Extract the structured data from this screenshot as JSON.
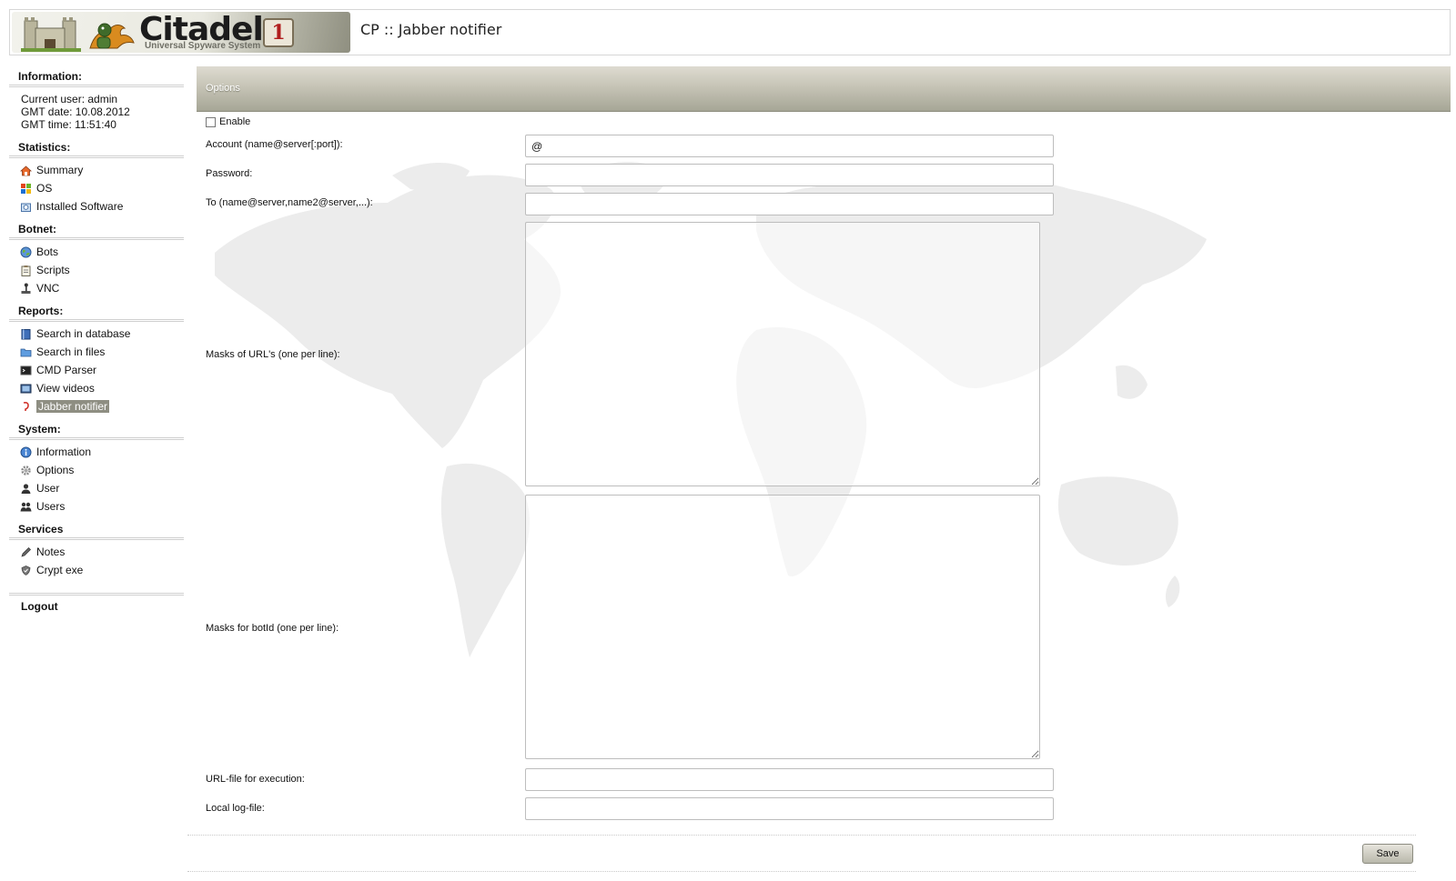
{
  "header": {
    "logo_text": "Citadel",
    "logo_badge": "1",
    "logo_subtitle": "Universal Spyware System",
    "page_title": "CP :: Jabber notifier"
  },
  "sidebar": {
    "information_title": "Information:",
    "info_lines": [
      "Current user: admin",
      "GMT date: 10.08.2012",
      "GMT time: 11:51:40"
    ],
    "statistics_title": "Statistics:",
    "statistics_items": [
      "Summary",
      "OS",
      "Installed Software"
    ],
    "botnet_title": "Botnet:",
    "botnet_items": [
      "Bots",
      "Scripts",
      "VNC"
    ],
    "reports_title": "Reports:",
    "reports_items": [
      "Search in database",
      "Search in files",
      "CMD Parser",
      "View videos",
      "Jabber notifier"
    ],
    "system_title": "System:",
    "system_items": [
      "Information",
      "Options",
      "User",
      "Users"
    ],
    "services_title": "Services",
    "services_items": [
      "Notes",
      "Crypt exe"
    ],
    "logout": "Logout",
    "active_item": "Jabber notifier"
  },
  "main": {
    "section_title": "Options",
    "enable_label": "Enable",
    "enable_checked": false,
    "account_label": "Account (name@server[:port]):",
    "account_value": "@",
    "password_label": "Password:",
    "password_value": "",
    "to_label": "To (name@server,name2@server,...):",
    "to_value": "",
    "url_masks_label": "Masks of URL's (one per line):",
    "botid_masks_label": "Masks for botId (one per line):",
    "url_file_label": "URL-file for execution:",
    "url_file_value": "",
    "log_file_label": "Local log-file:",
    "log_file_value": "",
    "save_label": "Save"
  },
  "colors": {
    "header_bar_light": "#dedbd1",
    "header_bar_dark": "#a6a696",
    "active_nav_bg": "#8e8e82",
    "map_gray": "#ebebeb"
  }
}
